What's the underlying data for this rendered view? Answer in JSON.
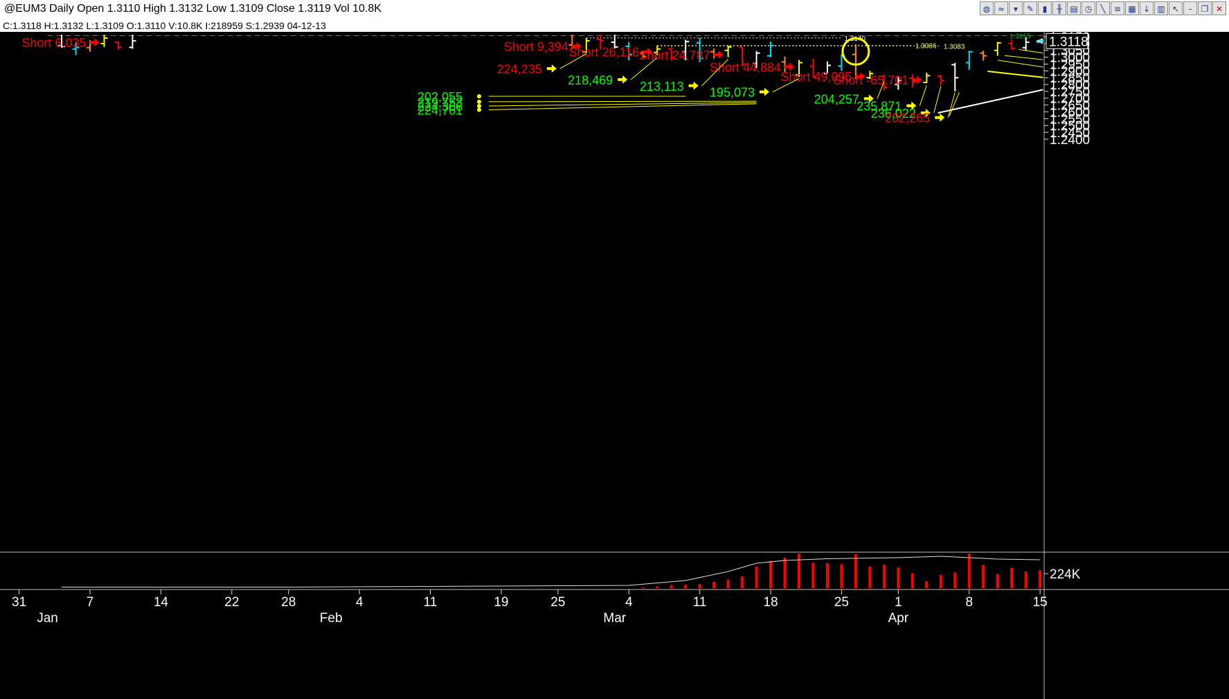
{
  "window": {
    "title": "@EUM3 Daily Open 1.3110 High 1.3132 Low 1.3109 Close 1.3119 Vol 10.8K",
    "info": "C:1.3118  H:1.3132  L:1.3109  O:1.3110  V:10.8K  I:218959  S:1.2939  04-12-13",
    "toolbar_icons": [
      "globe-icon",
      "wave-icon",
      "funnel-icon",
      "pencil-icon",
      "bar-chart-icon",
      "candles-icon",
      "page-icon",
      "clock-icon",
      "line-tool-icon",
      "fib-icon",
      "grid-icon",
      "down-arrow-icon",
      "trash-icon",
      "pointer-icon",
      "minimize-icon",
      "restore-icon",
      "close-icon"
    ]
  },
  "colors": {
    "background": "#000000",
    "red_label": "#ff0000",
    "green_label": "#00ff00",
    "yellow": "#ffff00",
    "cyan": "#00e5ff",
    "orange": "#ff8c1a",
    "white": "#ffffff",
    "volume": "#ff0000"
  },
  "chart_data": {
    "type": "bar",
    "symbol": "@EUM3",
    "ylim": [
      1.2375,
      1.3165
    ],
    "y_ticks": [
      "1.3150",
      "1.3100",
      "1.3050",
      "1.3000",
      "1.2950",
      "1.2900",
      "1.2850",
      "1.2800",
      "1.2750",
      "1.2700",
      "1.2650",
      "1.2600",
      "1.2550",
      "1.2500",
      "1.2450",
      "1.2400"
    ],
    "last_price_tag": "1.3118",
    "x_axis": {
      "day_ticks": [
        {
          "label": "31",
          "idx": -5
        },
        {
          "label": "7",
          "idx": 0
        },
        {
          "label": "14",
          "idx": 5
        },
        {
          "label": "22",
          "idx": 10
        },
        {
          "label": "28",
          "idx": 14
        },
        {
          "label": "4",
          "idx": 19
        },
        {
          "label": "11",
          "idx": 24
        },
        {
          "label": "19",
          "idx": 29
        },
        {
          "label": "25",
          "idx": 33
        },
        {
          "label": "4",
          "idx": 38
        },
        {
          "label": "11",
          "idx": 43
        },
        {
          "label": "18",
          "idx": 48
        },
        {
          "label": "25",
          "idx": 53
        },
        {
          "label": "1",
          "idx": 57
        },
        {
          "label": "8",
          "idx": 62
        },
        {
          "label": "15",
          "idx": 67
        }
      ],
      "month_ticks": [
        {
          "label": "Jan",
          "idx": -3
        },
        {
          "label": "Feb",
          "idx": 17
        },
        {
          "label": "Mar",
          "idx": 37
        },
        {
          "label": "Apr",
          "idx": 57
        }
      ]
    },
    "bars": [
      {
        "idx": -2,
        "o": 1.3085,
        "h": 1.3165,
        "l": 1.307,
        "c": 1.3078,
        "color": "white"
      },
      {
        "idx": -1,
        "o": 1.306,
        "h": 1.3108,
        "l": 1.3017,
        "c": 1.3072,
        "color": "cyan"
      },
      {
        "idx": 0,
        "o": 1.307,
        "h": 1.3125,
        "l": 1.304,
        "c": 1.311,
        "color": "orange"
      },
      {
        "idx": 1,
        "o": 1.31,
        "h": 1.3165,
        "l": 1.3075,
        "c": 1.314,
        "color": "yellow"
      },
      {
        "idx": 2,
        "o": 1.311,
        "h": 1.3115,
        "l": 1.3058,
        "c": 1.3075,
        "color": "red"
      },
      {
        "idx": 3,
        "o": 1.3072,
        "h": 1.3165,
        "l": 1.3062,
        "c": 1.312,
        "color": "white"
      },
      {
        "idx": 34,
        "o": 1.309,
        "h": 1.3165,
        "l": 1.306,
        "c": 1.3075,
        "color": "orange"
      },
      {
        "idx": 35,
        "o": 1.304,
        "h": 1.314,
        "l": 1.303,
        "c": 1.312,
        "color": "yellow"
      },
      {
        "idx": 36,
        "o": 1.313,
        "h": 1.3165,
        "l": 1.3055,
        "c": 1.312,
        "color": "red"
      },
      {
        "idx": 37,
        "o": 1.311,
        "h": 1.3165,
        "l": 1.3065,
        "c": 1.3075,
        "color": "white"
      },
      {
        "idx": 38,
        "o": 1.308,
        "h": 1.3112,
        "l": 1.2978,
        "c": 1.302,
        "color": "cyan"
      },
      {
        "idx": 39,
        "o": 1.303,
        "h": 1.3045,
        "l": 1.2995,
        "c": 1.3005,
        "color": "orange"
      },
      {
        "idx": 40,
        "o": 1.3035,
        "h": 1.3085,
        "l": 1.3015,
        "c": 1.306,
        "color": "yellow"
      },
      {
        "idx": 41,
        "o": 1.306,
        "h": 1.3078,
        "l": 1.2973,
        "c": 1.3,
        "color": "red"
      },
      {
        "idx": 42,
        "o": 1.304,
        "h": 1.3128,
        "l": 1.2978,
        "c": 1.3115,
        "color": "white"
      },
      {
        "idx": 43,
        "o": 1.3105,
        "h": 1.3142,
        "l": 1.2965,
        "c": 1.299,
        "color": "cyan"
      },
      {
        "idx": 44,
        "o": 1.304,
        "h": 1.3063,
        "l": 1.299,
        "c": 1.302,
        "color": "orange"
      },
      {
        "idx": 45,
        "o": 1.305,
        "h": 1.3085,
        "l": 1.3,
        "c": 1.3075,
        "color": "yellow"
      },
      {
        "idx": 46,
        "o": 1.3075,
        "h": 1.3077,
        "l": 1.293,
        "c": 1.295,
        "color": "red"
      },
      {
        "idx": 47,
        "o": 1.2955,
        "h": 1.3045,
        "l": 1.292,
        "c": 1.303,
        "color": "white"
      },
      {
        "idx": 48,
        "o": 1.301,
        "h": 1.3115,
        "l": 1.3,
        "c": 1.3085,
        "color": "cyan"
      },
      {
        "idx": 49,
        "o": 1.2965,
        "h": 1.3005,
        "l": 1.289,
        "c": 1.293,
        "color": "orange"
      },
      {
        "idx": 50,
        "o": 1.287,
        "h": 1.298,
        "l": 1.2855,
        "c": 1.296,
        "color": "yellow"
      },
      {
        "idx": 51,
        "o": 1.2935,
        "h": 1.299,
        "l": 1.285,
        "c": 1.286,
        "color": "red"
      },
      {
        "idx": 52,
        "o": 1.288,
        "h": 1.2968,
        "l": 1.2885,
        "c": 1.294,
        "color": "white"
      },
      {
        "idx": 53,
        "o": 1.2935,
        "h": 1.3022,
        "l": 1.29,
        "c": 1.301,
        "color": "cyan"
      },
      {
        "idx": 54,
        "o": 1.302,
        "h": 1.3095,
        "l": 1.284,
        "c": 1.2855,
        "color": "orange"
      },
      {
        "idx": 55,
        "o": 1.285,
        "h": 1.29,
        "l": 1.284,
        "c": 1.288,
        "color": "yellow"
      },
      {
        "idx": 56,
        "o": 1.286,
        "h": 1.2875,
        "l": 1.2758,
        "c": 1.278,
        "color": "red"
      },
      {
        "idx": 57,
        "o": 1.28,
        "h": 1.2855,
        "l": 1.2762,
        "c": 1.283,
        "color": "white"
      },
      {
        "idx": 58,
        "o": 1.2845,
        "h": 1.2877,
        "l": 1.2778,
        "c": 1.282,
        "color": "red"
      },
      {
        "idx": 59,
        "o": 1.2815,
        "h": 1.2887,
        "l": 1.281,
        "c": 1.2865,
        "color": "yellow"
      },
      {
        "idx": 60,
        "o": 1.286,
        "h": 1.2872,
        "l": 1.2795,
        "c": 1.283,
        "color": "red"
      },
      {
        "idx": 61,
        "o": 1.2945,
        "h": 1.2958,
        "l": 1.275,
        "c": 1.285,
        "color": "white"
      },
      {
        "idx": 62,
        "o": 1.296,
        "h": 1.3048,
        "l": 1.2908,
        "c": 1.304,
        "color": "cyan"
      },
      {
        "idx": 63,
        "o": 1.303,
        "h": 1.3048,
        "l": 1.2975,
        "c": 1.301,
        "color": "orange"
      },
      {
        "idx": 64,
        "o": 1.305,
        "h": 1.3112,
        "l": 1.301,
        "c": 1.3105,
        "color": "yellow"
      },
      {
        "idx": 65,
        "o": 1.31,
        "h": 1.3128,
        "l": 1.3058,
        "c": 1.3065,
        "color": "red"
      },
      {
        "idx": 66,
        "o": 1.307,
        "h": 1.3145,
        "l": 1.305,
        "c": 1.311,
        "color": "white"
      },
      {
        "idx": 67,
        "o": 1.311,
        "h": 1.3132,
        "l": 1.3109,
        "c": 1.3119,
        "color": "cyan"
      }
    ],
    "volume": {
      "axis_label": "224K",
      "bars": [
        {
          "idx": 39,
          "v": 2
        },
        {
          "idx": 40,
          "v": 5
        },
        {
          "idx": 41,
          "v": 9
        },
        {
          "idx": 42,
          "v": 10
        },
        {
          "idx": 43,
          "v": 12
        },
        {
          "idx": 44,
          "v": 18
        },
        {
          "idx": 45,
          "v": 25
        },
        {
          "idx": 46,
          "v": 34
        },
        {
          "idx": 47,
          "v": 62
        },
        {
          "idx": 48,
          "v": 78
        },
        {
          "idx": 49,
          "v": 88
        },
        {
          "idx": 50,
          "v": 100
        },
        {
          "idx": 51,
          "v": 73
        },
        {
          "idx": 52,
          "v": 72
        },
        {
          "idx": 53,
          "v": 69
        },
        {
          "idx": 54,
          "v": 98
        },
        {
          "idx": 55,
          "v": 62
        },
        {
          "idx": 56,
          "v": 68
        },
        {
          "idx": 57,
          "v": 60
        },
        {
          "idx": 58,
          "v": 43
        },
        {
          "idx": 59,
          "v": 20
        },
        {
          "idx": 60,
          "v": 38
        },
        {
          "idx": 61,
          "v": 45
        },
        {
          "idx": 62,
          "v": 100
        },
        {
          "idx": 63,
          "v": 67
        },
        {
          "idx": 64,
          "v": 41
        },
        {
          "idx": 65,
          "v": 58
        },
        {
          "idx": 66,
          "v": 48
        },
        {
          "idx": 67,
          "v": 52
        }
      ],
      "open_interest": [
        {
          "idx": -2,
          "v": 3
        },
        {
          "idx": 14,
          "v": 3
        },
        {
          "idx": 38,
          "v": 8
        },
        {
          "idx": 42,
          "v": 22
        },
        {
          "idx": 45,
          "v": 48
        },
        {
          "idx": 47,
          "v": 72
        },
        {
          "idx": 49,
          "v": 80
        },
        {
          "idx": 52,
          "v": 85
        },
        {
          "idx": 57,
          "v": 88
        },
        {
          "idx": 60,
          "v": 92
        },
        {
          "idx": 62,
          "v": 88
        },
        {
          "idx": 64,
          "v": 84
        },
        {
          "idx": 67,
          "v": 82
        }
      ]
    },
    "levels": [
      {
        "label": "1.3155",
        "price": 1.31575,
        "from_idx": -3,
        "to_idx": 68,
        "style": "dashed",
        "color": "green"
      },
      {
        "label": "1.3140",
        "price": 1.31405,
        "from_idx": 35,
        "to_idx": 53,
        "style": "dotted",
        "color": "white"
      },
      {
        "label": "1.3086",
        "price": 1.30855,
        "from_idx": 40,
        "to_idx": 58,
        "style": "dotted",
        "color": "yellow"
      },
      {
        "label": "1.3083",
        "price": 1.30825,
        "from_idx": 40,
        "to_idx": 60,
        "style": "dotted",
        "color": "yellow"
      }
    ],
    "short_annotations": [
      {
        "text": "Short  6,035",
        "idx": 1,
        "price": 1.3109
      },
      {
        "text": "Short  9,394",
        "idx": 35,
        "price": 1.3081
      },
      {
        "text": "Short  26,116",
        "idx": 40,
        "price": 1.304
      },
      {
        "text": "Short  24,787",
        "idx": 45,
        "price": 1.3019
      },
      {
        "text": "Short  44,884",
        "idx": 50,
        "price": 1.293
      },
      {
        "text": "Short  49,095",
        "idx": 55,
        "price": 1.286
      },
      {
        "text": "Short  -65,701",
        "idx": 59,
        "price": 1.2835
      }
    ],
    "oi_annotations": [
      {
        "text": "224,235",
        "color": "red",
        "marker": "arrow",
        "price": 1.2917,
        "end_idx": 35,
        "end_price": 1.3025
      },
      {
        "text": "218,469",
        "color": "green",
        "marker": "arrow",
        "price": 1.2836,
        "end_idx": 40,
        "end_price": 1.2998
      },
      {
        "text": "213,113",
        "color": "green",
        "marker": "arrow",
        "price": 1.2791,
        "end_idx": 45,
        "end_price": 1.2985
      },
      {
        "text": "195,073",
        "color": "green",
        "marker": "arrow",
        "price": 1.2746,
        "end_idx": 50,
        "end_price": 1.2843
      },
      {
        "text": "202,055",
        "color": "green",
        "marker": "dot",
        "price": 1.2714,
        "end_idx": 42,
        "end_price": 1.2714
      },
      {
        "text": "219,753",
        "color": "green",
        "marker": "dot",
        "price": 1.2674,
        "end_idx": 47,
        "end_price": 1.2678
      },
      {
        "text": "224,366",
        "color": "green",
        "marker": "dot",
        "price": 1.2643,
        "end_idx": 47,
        "end_price": 1.2668
      },
      {
        "text": "224,761",
        "color": "green",
        "marker": "dot",
        "price": 1.2615,
        "end_idx": 47,
        "end_price": 1.2659
      },
      {
        "text": "204,257",
        "color": "green",
        "marker": "arrow",
        "price": 1.2697,
        "end_idx": 56,
        "end_price": 1.2822
      },
      {
        "text": "235,871",
        "color": "green",
        "marker": "arrow",
        "price": 1.2645,
        "end_idx": 59,
        "end_price": 1.2793
      },
      {
        "text": "236,022",
        "color": "green",
        "marker": "arrow",
        "price": 1.2592,
        "end_idx": 60,
        "end_price": 1.2787
      },
      {
        "text": "232,265",
        "color": "red",
        "marker": "arrow",
        "price": 1.2558,
        "end_idx": 61,
        "end_price": 1.2742
      }
    ],
    "trendlines": [
      {
        "color": "yellow",
        "width": 1,
        "from": [
          64,
          1.2978
        ],
        "to": [
          67.2,
          1.2928
        ]
      },
      {
        "color": "yellow",
        "width": 1,
        "from": [
          64.5,
          1.3012
        ],
        "to": [
          67.2,
          1.2982
        ]
      },
      {
        "color": "yellow",
        "width": 1,
        "from": [
          65.5,
          1.3057
        ],
        "to": [
          67.2,
          1.303
        ]
      },
      {
        "color": "yellow",
        "width": 2,
        "from": [
          63.3,
          1.2897
        ],
        "to": [
          67.2,
          1.2852
        ]
      },
      {
        "color": "white",
        "width": 2,
        "from": [
          59.8,
          1.2592
        ],
        "to": [
          67.2,
          1.2762
        ]
      },
      {
        "color": "yellow",
        "width": 1,
        "from": [
          60.6,
          1.257
        ],
        "to": [
          61.3,
          1.2743
        ]
      }
    ],
    "circle": {
      "idx": 54,
      "price": 1.3042
    }
  }
}
